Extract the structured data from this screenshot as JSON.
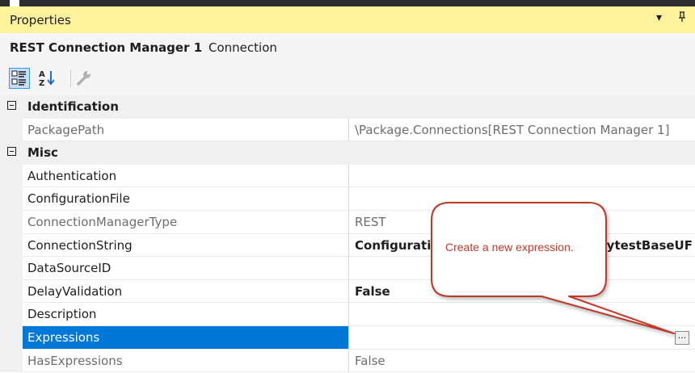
{
  "panel": {
    "title": "Properties",
    "dropdown_icon": "dropdown-arrow-icon",
    "pin_icon": "pin-icon"
  },
  "object": {
    "name": "REST Connection Manager 1",
    "type": "Connection"
  },
  "toolbar": {
    "categorized_icon": "categorized-view-icon",
    "alphabetical_icon": "alphabetical-sort-icon",
    "property_pages_icon": "wrench-icon"
  },
  "categories": {
    "identification": "Identification",
    "misc": "Misc"
  },
  "properties": {
    "package_path": {
      "name": "PackagePath",
      "value": "\\Package.Connections[REST Connection Manager 1]"
    },
    "authentication": {
      "name": "Authentication",
      "value": ""
    },
    "configuration_file": {
      "name": "ConfigurationFile",
      "value": ""
    },
    "connection_manager_type": {
      "name": "ConnectionManagerType",
      "value": "REST"
    },
    "connection_string": {
      "name": "ConnectionString",
      "value": "Configuratio",
      "value_tail": "nytestBaseUF"
    },
    "data_source_id": {
      "name": "DataSourceID",
      "value": ""
    },
    "delay_validation": {
      "name": "DelayValidation",
      "value": "False"
    },
    "description": {
      "name": "Description",
      "value": ""
    },
    "expressions": {
      "name": "Expressions",
      "value": ""
    },
    "has_expressions": {
      "name": "HasExpressions",
      "value": "False"
    }
  },
  "expressions_button": {
    "label": "..."
  },
  "callout": {
    "text": "Create a new expression."
  },
  "colors": {
    "title_bar": "#fff29d",
    "selection": "#0078d7",
    "callout_fill": "#ffffff",
    "callout_border": "#c0392b",
    "callout_text": "#c0392b"
  }
}
